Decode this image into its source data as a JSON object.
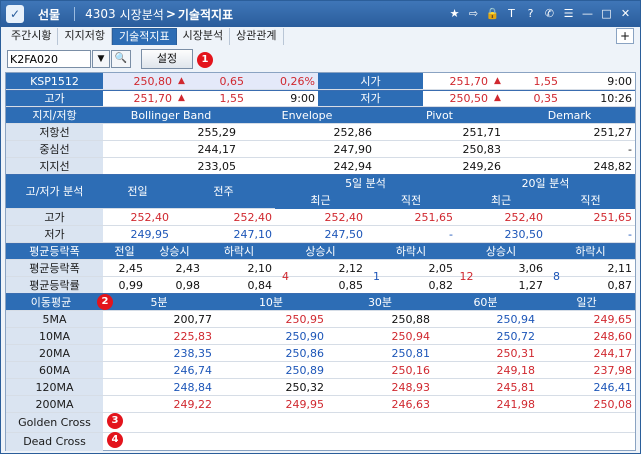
{
  "title": {
    "market": "선물",
    "code": "4303",
    "section": "시장분석",
    "arrow": ">",
    "page": "기술적지표"
  },
  "title_icons": [
    "star-icon",
    "export-icon",
    "lock-icon",
    "text-icon",
    "help-icon",
    "phone-icon",
    "menu-icon",
    "minimize-icon",
    "maximize-icon",
    "close-icon"
  ],
  "title_icon_glyphs": [
    "★",
    "⇨",
    "🔒",
    "T",
    "?",
    "✆",
    "☰",
    "—",
    "□",
    "✕"
  ],
  "tabs": [
    "주간시황",
    "지지저항",
    "기술적지표",
    "시장분석",
    "상관관계"
  ],
  "active_tab": 2,
  "tab_plus": "+",
  "toolbar": {
    "code_value": "K2FA020",
    "dropdown": "▼",
    "search": "🔍",
    "settings_label": "설정"
  },
  "badges": [
    "1",
    "2",
    "3",
    "4"
  ],
  "quote": {
    "row1": {
      "name": "KSP1512",
      "price": "250,80",
      "change": "0,65",
      "rate": "0,26%",
      "open_label": "시가",
      "open": "251,70",
      "open_change": "1,55",
      "open_time": "9:00"
    },
    "row2": {
      "high_label": "고가",
      "high": "251,70",
      "high_change": "1,55",
      "high_time": "9:00",
      "low_label": "저가",
      "low": "250,50",
      "low_change": "0,35",
      "low_time": "10:26"
    }
  },
  "sr": {
    "headers": [
      "지지/저항",
      "Bollinger Band",
      "Envelope",
      "Pivot",
      "Demark"
    ],
    "rows": [
      {
        "label": "저항선",
        "bb": "255,29",
        "env": "252,86",
        "pivot": "251,71",
        "demark": "251,27"
      },
      {
        "label": "중심선",
        "bb": "244,17",
        "env": "247,90",
        "pivot": "250,83",
        "demark": "-"
      },
      {
        "label": "지지선",
        "bb": "233,05",
        "env": "242,94",
        "pivot": "249,26",
        "demark": "248,82"
      }
    ]
  },
  "hl": {
    "title": "고/저가 분석",
    "prev_day": "전일",
    "prev_week": "전주",
    "five": "5일 분석",
    "twenty": "20일 분석",
    "recent": "최근",
    "prior": "직전",
    "rows": [
      {
        "label": "고가",
        "v": [
          "252,40",
          "252,40",
          "252,40",
          "251,65",
          "252,40",
          "251,65"
        ]
      },
      {
        "label": "저가",
        "v": [
          "249,95",
          "247,10",
          "247,50",
          "-",
          "230,50",
          "-"
        ]
      }
    ]
  },
  "avg": {
    "title": "평균등락폭",
    "prev": "전일",
    "up": "상승시",
    "down": "하락시",
    "rows": [
      {
        "label": "평균등락폭",
        "v": [
          "2,45",
          "2,43",
          "2,10",
          "2,12",
          "2,05",
          "3,06",
          "2,11"
        ]
      },
      {
        "label": "평균등락률",
        "v": [
          "0,99",
          "0,98",
          "0,84",
          "0,85",
          "0,82",
          "1,27",
          "0,87"
        ]
      }
    ],
    "counts": [
      "4",
      "1",
      "12",
      "8"
    ]
  },
  "ma": {
    "title": "이동평균",
    "periods": [
      "5분",
      "10분",
      "30분",
      "60분",
      "일간"
    ],
    "rows": [
      {
        "label": "5MA",
        "v": [
          "200,77",
          "250,95",
          "250,88",
          "250,94",
          "249,65"
        ]
      },
      {
        "label": "10MA",
        "v": [
          "225,83",
          "250,90",
          "250,94",
          "250,72",
          "248,60"
        ]
      },
      {
        "label": "20MA",
        "v": [
          "238,35",
          "250,86",
          "250,81",
          "250,31",
          "244,17"
        ]
      },
      {
        "label": "60MA",
        "v": [
          "246,74",
          "250,89",
          "250,16",
          "249,18",
          "237,98"
        ]
      },
      {
        "label": "120MA",
        "v": [
          "248,84",
          "250,32",
          "248,93",
          "245,81",
          "246,41"
        ]
      },
      {
        "label": "200MA",
        "v": [
          "249,22",
          "249,95",
          "246,63",
          "241,98",
          "250,08"
        ]
      }
    ],
    "golden": "Golden Cross",
    "dead": "Dead Cross"
  },
  "colors": {
    "header_blue": "#2d6db5",
    "label_bg": "#dae4f1",
    "up_red": "#d0282f",
    "down_blue": "#1d56b8",
    "badge_red": "#e3141c"
  }
}
